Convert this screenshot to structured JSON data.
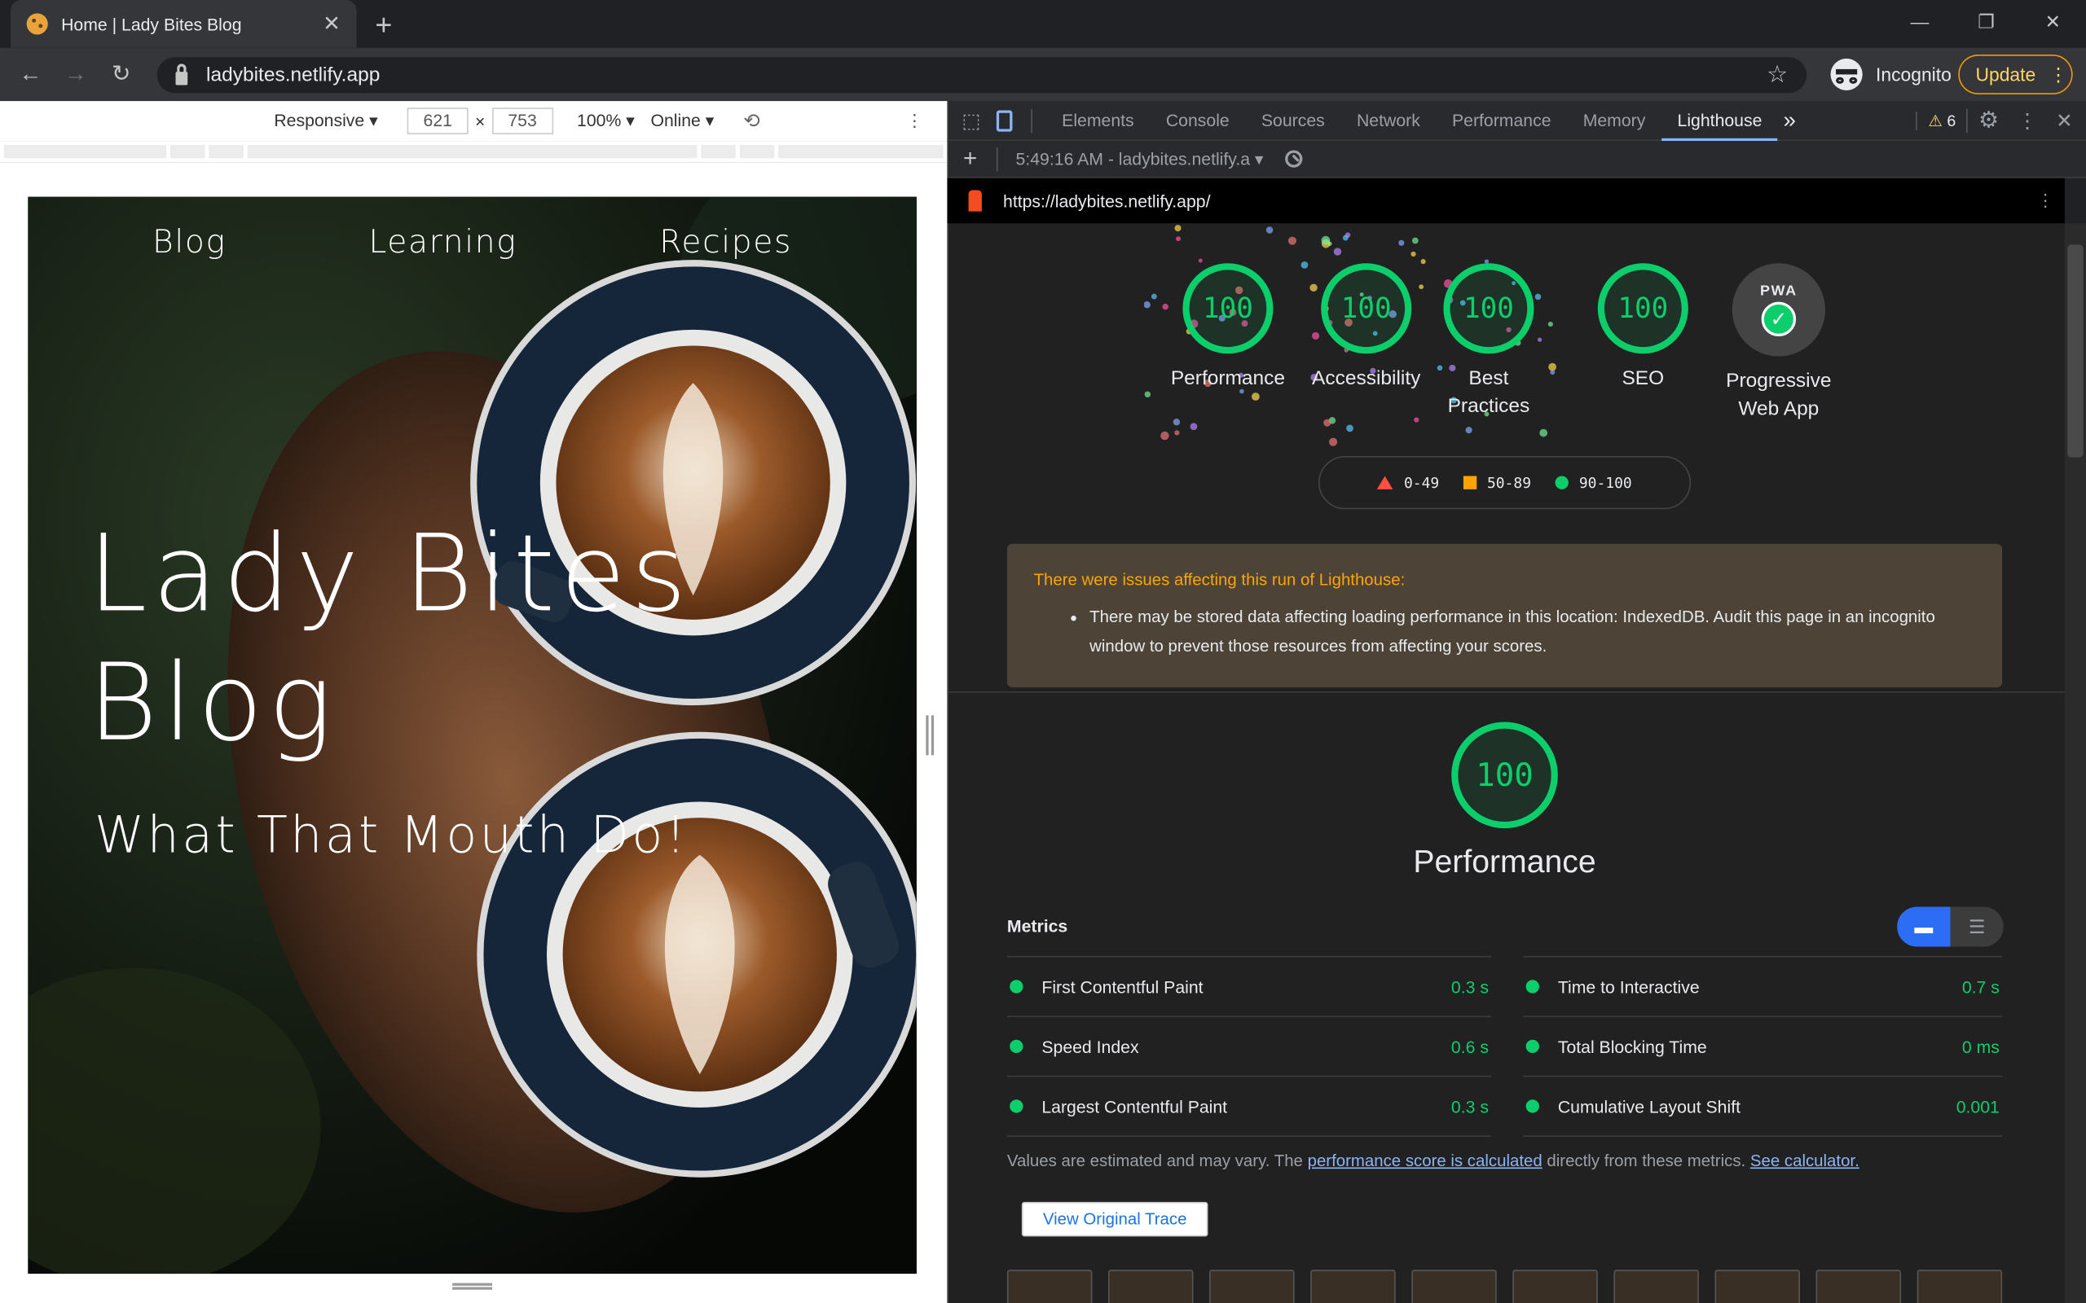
{
  "browser": {
    "tab_title": "Home | Lady Bites Blog",
    "url": "ladybites.netlify.app",
    "incognito_label": "Incognito",
    "update_label": "Update"
  },
  "device_toolbar": {
    "mode": "Responsive",
    "width": "621",
    "height": "753",
    "times": "×",
    "zoom": "100%",
    "network": "Online"
  },
  "page": {
    "nav": [
      "Blog",
      "Learning",
      "Recipes"
    ],
    "title_line1": "Lady Bites",
    "title_line2": "Blog",
    "subtitle": "What That Mouth Do!"
  },
  "devtools": {
    "tabs": [
      "Elements",
      "Console",
      "Sources",
      "Network",
      "Performance",
      "Memory",
      "Lighthouse"
    ],
    "active_tab": "Lighthouse",
    "more": "»",
    "warning_count": "6",
    "report_select": "5:49:16 AM - ladybites.netlify.a"
  },
  "lighthouse": {
    "report_url": "https://ladybites.netlify.app/",
    "gauges": [
      {
        "score": "100",
        "label": "Performance"
      },
      {
        "score": "100",
        "label": "Accessibility"
      },
      {
        "score": "100",
        "label": "Best Practices"
      },
      {
        "score": "100",
        "label": "SEO"
      }
    ],
    "pwa_label": "Progressive Web App",
    "pwa_badge": "PWA",
    "legend": [
      {
        "range": "0-49",
        "color": "#ff4e42"
      },
      {
        "range": "50-89",
        "color": "#ffa400"
      },
      {
        "range": "90-100",
        "color": "#0cce6b"
      }
    ],
    "warning_heading": "There were issues affecting this run of Lighthouse:",
    "warning_item": "There may be stored data affecting loading performance in this location: IndexedDB. Audit this page in an incognito window to prevent those resources from affecting your scores.",
    "perf_score": "100",
    "perf_title": "Performance",
    "metrics_heading": "Metrics",
    "metrics_left": [
      {
        "name": "First Contentful Paint",
        "value": "0.3 s"
      },
      {
        "name": "Speed Index",
        "value": "0.6 s"
      },
      {
        "name": "Largest Contentful Paint",
        "value": "0.3 s"
      }
    ],
    "metrics_right": [
      {
        "name": "Time to Interactive",
        "value": "0.7 s"
      },
      {
        "name": "Total Blocking Time",
        "value": "0 ms"
      },
      {
        "name": "Cumulative Layout Shift",
        "value": "0.001"
      }
    ],
    "note_prefix": "Values are estimated and may vary. The ",
    "note_link": "performance score is calculated",
    "note_mid": " directly from these metrics. ",
    "note_link2": "See calculator.",
    "trace_button": "View Original Trace"
  },
  "colors": {
    "pass": "#0cce6b",
    "warn_bg": "#4d4437",
    "accent": "#8ab4f8"
  }
}
